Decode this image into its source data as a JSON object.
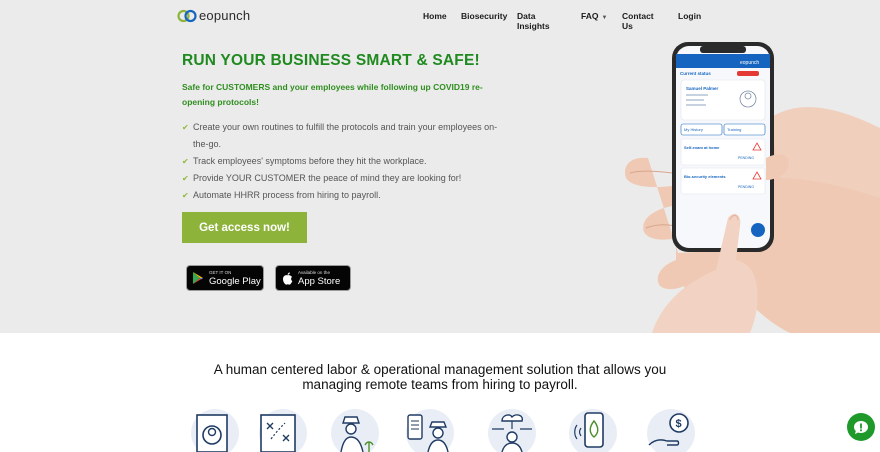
{
  "brand": {
    "name": "eopunch"
  },
  "nav": {
    "items": [
      "Home",
      "Biosecurity",
      "Data Insights",
      "FAQ",
      "Contact Us",
      "Login"
    ]
  },
  "hero": {
    "headline": "RUN YOUR BUSINESS SMART & SAFE!",
    "subheadline": "Safe for CUSTOMERS and your employees while following up COVID19 re-opening protocols!",
    "features": [
      "Create your own routines to fulfill the protocols and train your employees on-the-go.",
      "Track employees' symptoms before they hit the workplace.",
      "Provide YOUR CUSTOMER the peace of mind they are looking for!",
      "Automate HHRR process from hiring to payroll."
    ],
    "cta_label": "Get access now!",
    "google_play": {
      "small": "GET IT ON",
      "big": "Google Play"
    },
    "app_store": {
      "small": "Available on the",
      "big": "App Store"
    }
  },
  "phone": {
    "brand": "eopunch",
    "current_status": "Current status",
    "name": "Samuel Palmer",
    "my_history": "My History",
    "training": "Training",
    "card1": "Self-exam at home",
    "card2": "Bio-security elements",
    "pending": "PENDING"
  },
  "mission": {
    "line1": "A human centered labor & operational management solution that allows you",
    "line2": "managing remote teams from hiring to payroll."
  },
  "colors": {
    "green_dark": "#1f8a1f",
    "green_cta": "#8db33b",
    "chat": "#1f9a2a",
    "hero_bg": "#ebebeb",
    "phone_blue": "#1565c0"
  }
}
